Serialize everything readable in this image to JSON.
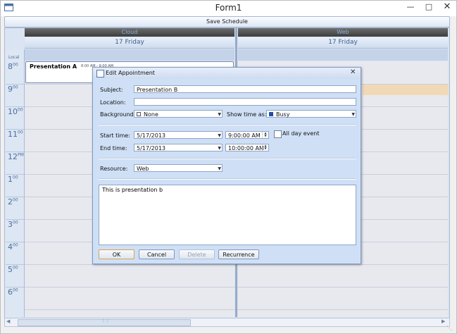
{
  "window": {
    "title": "Form1"
  },
  "toolbar": {
    "save_label": "Save Schedule"
  },
  "scheduler": {
    "resources": [
      "Cloud",
      "Web"
    ],
    "day_label": "17 Friday",
    "timescale_label": "Local",
    "hours": [
      {
        "h": "8",
        "m": "00"
      },
      {
        "h": "9",
        "m": "00"
      },
      {
        "h": "10",
        "m": "00"
      },
      {
        "h": "11",
        "m": "00"
      },
      {
        "h": "12",
        "m": "PM"
      },
      {
        "h": "1",
        "m": "00"
      },
      {
        "h": "2",
        "m": "00"
      },
      {
        "h": "3",
        "m": "00"
      },
      {
        "h": "4",
        "m": "00"
      },
      {
        "h": "5",
        "m": "00"
      },
      {
        "h": "6",
        "m": "00"
      }
    ],
    "appointment": {
      "title": "Presentation A",
      "time": "8:00 AM - 9:00 AM"
    },
    "colors": {
      "accent": "#dae4f2",
      "highlight": "#f1d9b6",
      "header_dark": "#3d3d3d"
    }
  },
  "dialog": {
    "title": "Edit Appointment",
    "subject_label": "Subject:",
    "subject_value": "Presentation B",
    "location_label": "Location:",
    "location_value": "",
    "background_label": "Background:",
    "background_value": "None",
    "show_time_label": "Show time as:",
    "show_time_value": "Busy",
    "start_label": "Start time:",
    "start_date": "5/17/2013",
    "start_time": "9:00:00 AM",
    "end_label": "End time:",
    "end_date": "5/17/2013",
    "end_time": "10:00:00 AM",
    "all_day_label": "All day event",
    "resource_label": "Resource:",
    "resource_value": "Web",
    "description": "This is presentation b",
    "buttons": {
      "ok": "OK",
      "cancel": "Cancel",
      "delete": "Delete",
      "recurrence": "Recurrence"
    }
  }
}
